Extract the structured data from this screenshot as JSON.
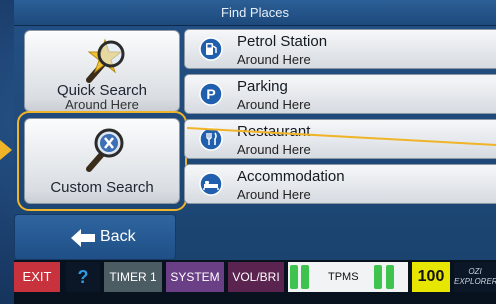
{
  "header": {
    "title": "Find Places"
  },
  "quick_search": {
    "label": "Quick Search",
    "sub": "Around Here"
  },
  "custom_search": {
    "label": "Custom Search"
  },
  "places": [
    {
      "name": "Petrol Station",
      "sub": "Around Here",
      "icon": "fuel-pump-icon"
    },
    {
      "name": "Parking",
      "sub": "Around Here",
      "icon": "parking-icon"
    },
    {
      "name": "Restaurant",
      "sub": "Around Here",
      "icon": "restaurant-icon"
    },
    {
      "name": "Accommodation",
      "sub": "Around Here",
      "icon": "bed-icon"
    }
  ],
  "back": {
    "label": "Back"
  },
  "toolbar": {
    "exit": "EXIT",
    "help": "?",
    "timer": "TIMER 1",
    "system": "SYSTEM",
    "volbri": "VOL/BRI",
    "tpms": "TPMS",
    "counter": "100",
    "ozi_line1": "OZI",
    "ozi_line2": "EXPLORER"
  },
  "colors": {
    "accent_highlight": "#f0b429",
    "exit": "#c8323c",
    "timer": "#4c5c63",
    "system": "#6b3f86",
    "volbri": "#5b2350",
    "counter": "#e6e600",
    "tpms_indicator": "#3fc34f"
  }
}
